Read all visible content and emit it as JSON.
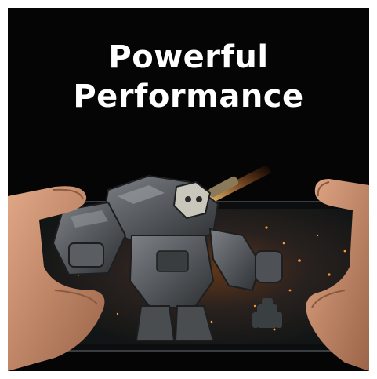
{
  "headline": {
    "line1": "Powerful",
    "line2": "Performance"
  },
  "colors": {
    "background": "#050505",
    "headline_text": "#ffffff",
    "screen_dark": "#1c2222",
    "robot_armor": "#4a4d50",
    "fire_orange": "#ff8a2a",
    "skin": "#c9906c"
  }
}
